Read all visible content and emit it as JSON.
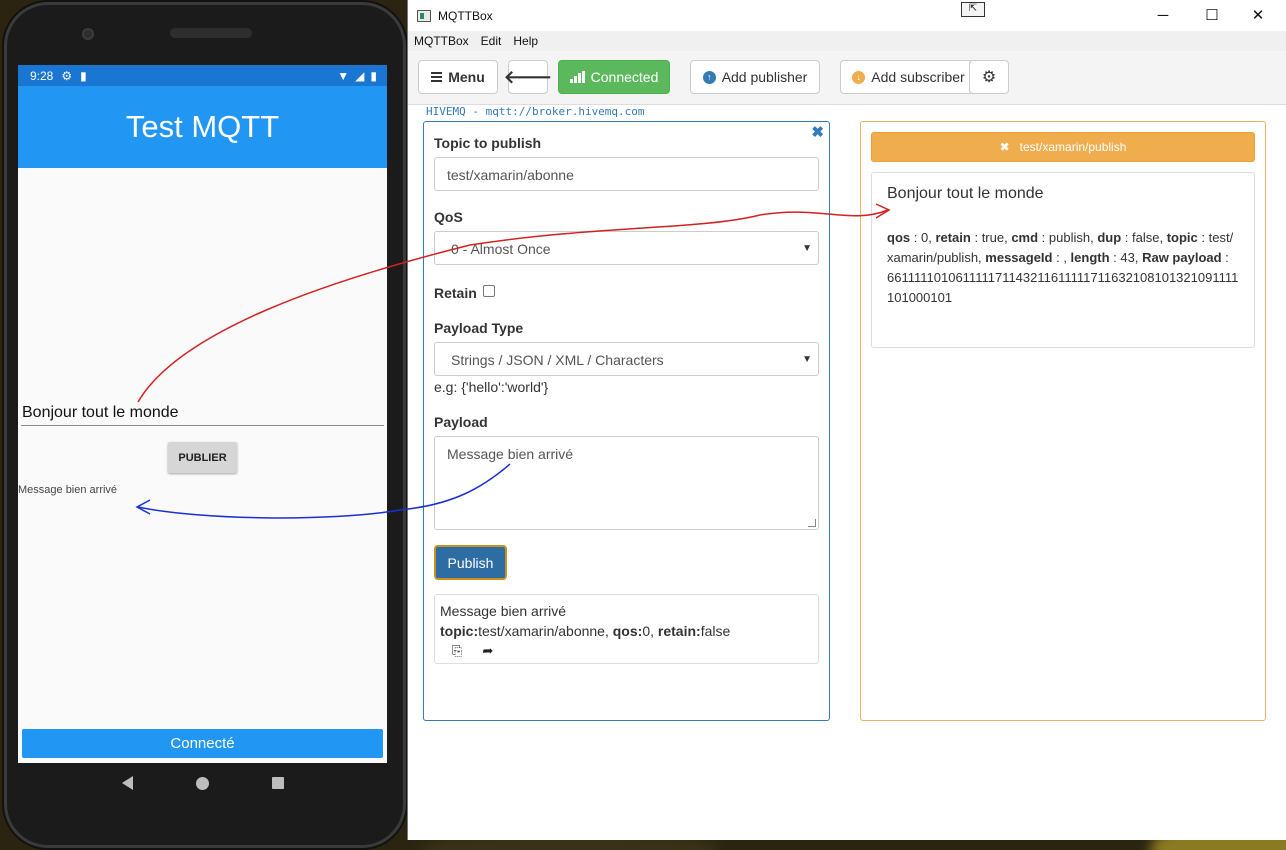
{
  "phone": {
    "status_time": "9:28",
    "app_title": "Test MQTT",
    "entry_text": "Bonjour tout le monde",
    "publish_button": "PUBLIER",
    "received_message": "Message bien arrivé",
    "connected_button": "Connecté"
  },
  "window": {
    "title": "MQTTBox",
    "menu": [
      "MQTTBox",
      "Edit",
      "Help"
    ]
  },
  "toolbar": {
    "menu_label": "Menu",
    "connected_label": "Connected",
    "add_publisher_label": "Add publisher",
    "add_subscriber_label": "Add subscriber"
  },
  "connection_label": "HIVEMQ - mqtt://broker.hivemq.com",
  "publisher": {
    "topic_label": "Topic to publish",
    "topic_value": "test/xamarin/abonne",
    "qos_label": "QoS",
    "qos_value": "0 - Almost Once",
    "retain_label": "Retain",
    "payload_type_label": "Payload Type",
    "payload_type_value": "Strings / JSON / XML / Characters",
    "payload_hint": "e.g: {'hello':'world'}",
    "payload_label": "Payload",
    "payload_value": "Message bien arrivé",
    "publish_button": "Publish",
    "history": {
      "message": "Message bien arrivé",
      "topic_key": "topic:",
      "topic": "test/xamarin/abonne",
      "qos_key": "qos:",
      "qos": "0",
      "retain_key": "retain:",
      "retain": "false"
    }
  },
  "subscriber": {
    "topic": "test/xamarin/publish",
    "message": "Bonjour tout le monde",
    "meta": {
      "qos_key": "qos",
      "qos": "0",
      "retain_key": "retain",
      "retain": "true",
      "cmd_key": "cmd",
      "cmd": "publish",
      "dup_key": "dup",
      "dup": "false",
      "topic_key": "topic",
      "topic": "test/xamarin/publish",
      "messageId_key": "messageId",
      "length_key": "length",
      "length": "43",
      "raw_key": "Raw payload",
      "raw": "661111101061111171143211611111711632108101321091111101000101"
    }
  },
  "colors": {
    "phone_appbar": "#2196f3",
    "connected_green": "#5cb85c",
    "publisher_border": "#337ab7",
    "subscriber_topic": "#f0ad4e",
    "red_arrow": "#d42020",
    "blue_arrow": "#1a2fd0"
  }
}
